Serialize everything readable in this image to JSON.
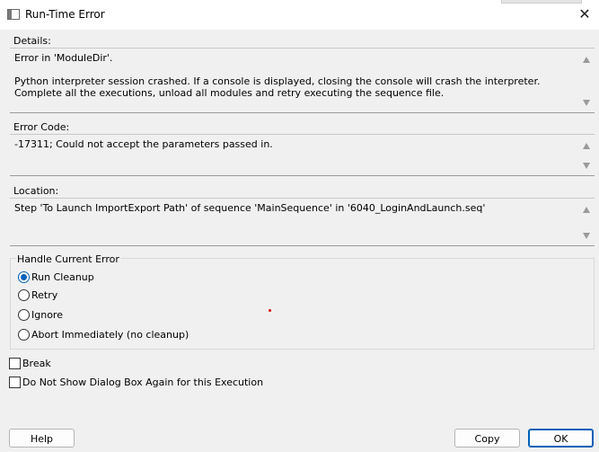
{
  "window": {
    "title": "Run-Time Error",
    "close_glyph": "✕"
  },
  "details": {
    "label": "Details:",
    "text": "Error in 'ModuleDir'.\n\nPython interpreter session crashed. If a console is displayed, closing the console will crash the interpreter. Complete all the executions, unload all modules and retry executing the sequence file."
  },
  "error_code": {
    "label": "Error Code:",
    "text": "-17311; Could not accept the parameters passed in."
  },
  "location": {
    "label": "Location:",
    "text": "Step 'To Launch ImportExport Path' of sequence 'MainSequence' in '6040_LoginAndLaunch.seq'"
  },
  "handle_group": {
    "title": "Handle Current Error",
    "options": [
      {
        "label": "Run Cleanup",
        "selected": true
      },
      {
        "label": "Retry",
        "selected": false
      },
      {
        "label": "Ignore",
        "selected": false
      },
      {
        "label": "Abort Immediately (no cleanup)",
        "selected": false
      }
    ]
  },
  "checkboxes": [
    {
      "label": "Break",
      "checked": false
    },
    {
      "label": "Do Not Show Dialog Box Again for this Execution",
      "checked": false
    }
  ],
  "buttons": {
    "help": "Help",
    "copy": "Copy",
    "ok": "OK"
  },
  "colors": {
    "accent": "#005fb8",
    "dialog_bg": "#f0f0f0",
    "titlebar_bg": "#ffffff"
  }
}
